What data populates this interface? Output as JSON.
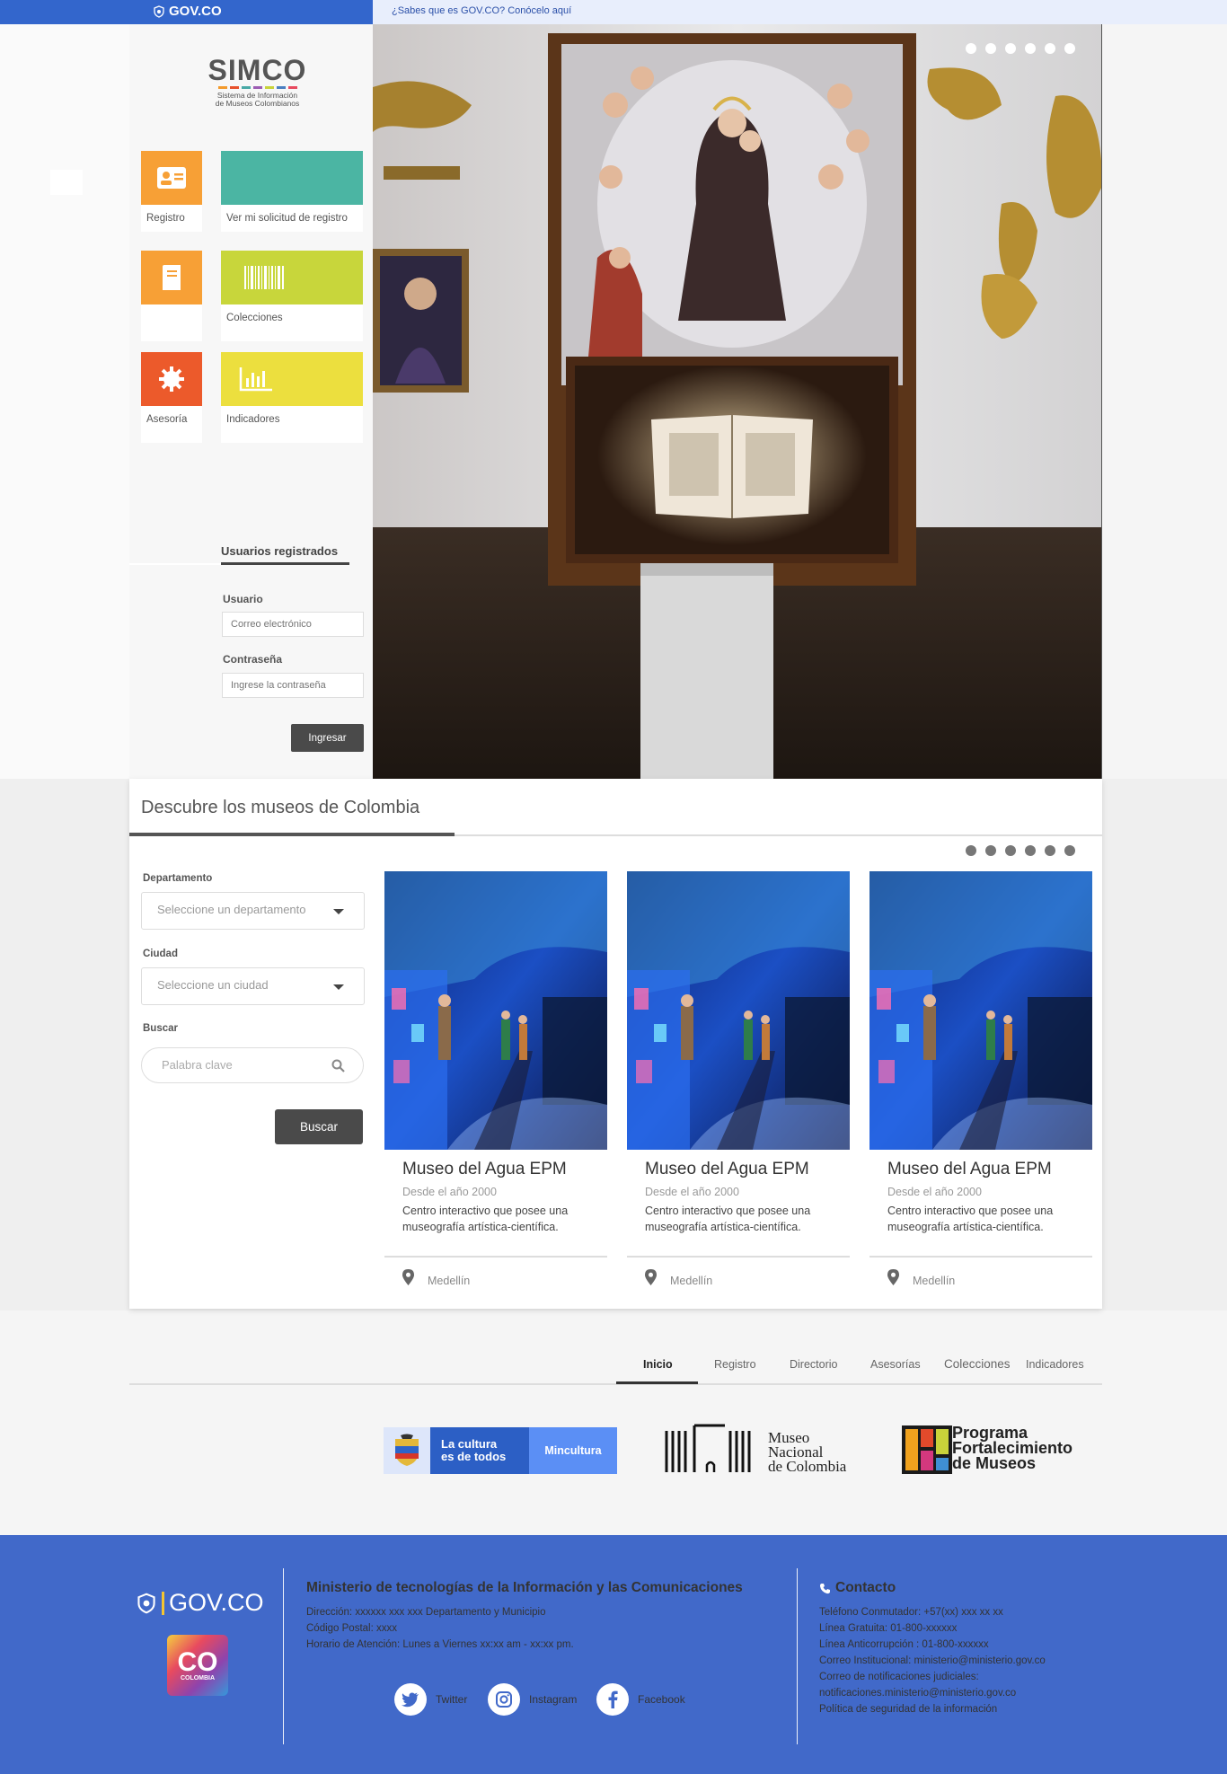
{
  "topbar": {
    "gov_logo": "GOV.CO",
    "gov_link": "¿Sabes que es GOV.CO? Conócelo aquí"
  },
  "brand": {
    "title": "SIMCO",
    "subtitle_line1": "Sistema de Información",
    "subtitle_line2": "de Museos Colombianos",
    "bar_colors": [
      "#f39a2c",
      "#e8512c",
      "#48a9a6",
      "#9c5db3",
      "#c8d33a",
      "#4a7fc1",
      "#e84a5f"
    ]
  },
  "tiles": [
    {
      "label": "Registro",
      "color": "#f7a036",
      "icon": "id-card-icon"
    },
    {
      "label": "Ver mi solicitud de registro",
      "color": "#4bb5a3",
      "icon": ""
    },
    {
      "label": "",
      "color": "#f7a036",
      "icon": "book-icon"
    },
    {
      "label": "Colecciones",
      "color": "#c8d63b",
      "icon": "barcode-icon"
    },
    {
      "label": "Asesoría",
      "color": "#ec5a2b",
      "icon": "gear-icon"
    },
    {
      "label": "Indicadores",
      "color": "#ecdf3e",
      "icon": "bar-chart-icon"
    }
  ],
  "login": {
    "tab": "Usuarios registrados",
    "user_label": "Usuario",
    "user_placeholder": "Correo electrónico",
    "pass_label": "Contraseña",
    "pass_placeholder": "Ingrese la contraseña",
    "submit": "Ingresar"
  },
  "hero": {
    "slide_count": 6,
    "active_slide": 6
  },
  "discover": {
    "title": "Descubre los museos de Colombia",
    "dept_label": "Departamento",
    "dept_placeholder": "Seleccione un departamento",
    "city_label": "Ciudad",
    "city_placeholder": "Seleccione un ciudad",
    "search_label": "Buscar",
    "search_placeholder": "Palabra clave",
    "search_button": "Buscar",
    "slide_count": 6
  },
  "museums": [
    {
      "name": "Museo del Agua EPM",
      "since": "Desde el año 2000",
      "description": "Centro interactivo que posee una museografía artística-científica.",
      "city": "Medellín"
    },
    {
      "name": "Museo del Agua EPM",
      "since": "Desde el año 2000",
      "description": "Centro interactivo que posee una museografía artística-científica.",
      "city": "Medellín"
    },
    {
      "name": "Museo del Agua EPM",
      "since": "Desde el año 2000",
      "description": "Centro interactivo que posee una museografía artística-científica.",
      "city": "Medellín"
    }
  ],
  "nav": {
    "items": [
      "Inicio",
      "Registro",
      "Directorio",
      "Asesorías",
      "Colecciones",
      "Indicadores"
    ],
    "active": "Inicio"
  },
  "partners": {
    "mincultura_slogan_1": "La cultura",
    "mincultura_slogan_2": "es de todos",
    "mincultura_name": "Mincultura",
    "museo_line1": "Museo",
    "museo_line2": "Nacional",
    "museo_line3": "de Colombia",
    "programa_line1": "Programa",
    "programa_line2": "Fortalecimiento",
    "programa_line3": "de Museos"
  },
  "footer": {
    "gov_logo": "GOV.CO",
    "co_brand": "CO",
    "co_label": "COLOMBIA",
    "ministry_title": "Ministerio de tecnologías de la Información y las Comunicaciones",
    "address": "Dirección: xxxxxx xxx xxx Departamento y Municipio",
    "postal": "Código Postal: xxxx",
    "hours": "Horario de Atención: Lunes a Viernes xx:xx am - xx:xx pm.",
    "contact_title": "Contacto",
    "contact_lines": [
      "Teléfono Conmutador: +57(xx) xxx xx xx",
      "Línea Gratuita: 01-800-xxxxxx",
      "Línea Anticorrupción : 01-800-xxxxxx",
      "Correo Institucional: ministerio@ministerio.gov.co",
      "Correo de notificaciones judiciales:",
      "notificaciones.ministerio@ministerio.gov.co",
      "Política de seguridad de la información"
    ],
    "social": [
      "Twitter",
      "Instagram",
      "Facebook"
    ]
  }
}
